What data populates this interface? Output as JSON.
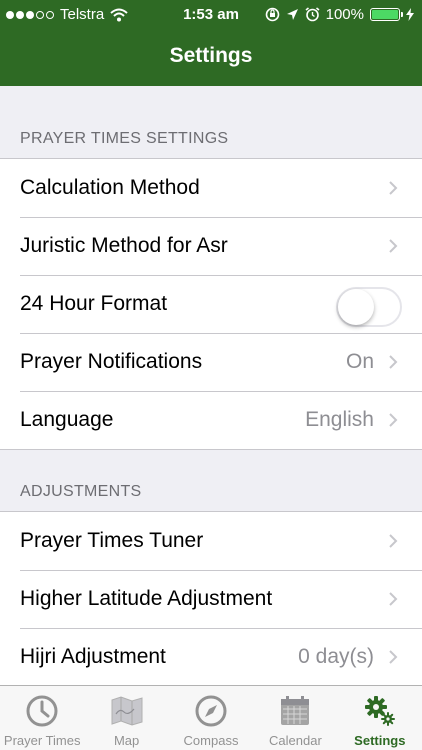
{
  "statusbar": {
    "carrier": "Telstra",
    "time": "1:53 am",
    "battery": "100%",
    "battery_level": 1.0
  },
  "nav": {
    "title": "Settings"
  },
  "colors": {
    "brand": "#2e6a24",
    "battery": "#4cd964",
    "tab_inactive": "#929292"
  },
  "sections": [
    {
      "header": "PRAYER TIMES SETTINGS",
      "rows": [
        {
          "label": "Calculation Method",
          "value": ""
        },
        {
          "label": "Juristic Method for Asr",
          "value": ""
        },
        {
          "label": "24 Hour Format",
          "toggle": false
        },
        {
          "label": "Prayer Notifications",
          "value": "On"
        },
        {
          "label": "Language",
          "value": "English"
        }
      ]
    },
    {
      "header": "ADJUSTMENTS",
      "rows": [
        {
          "label": "Prayer Times Tuner",
          "value": ""
        },
        {
          "label": "Higher Latitude Adjustment",
          "value": ""
        },
        {
          "label": "Hijri Adjustment",
          "value": "0 day(s)"
        }
      ]
    }
  ],
  "tabs": [
    {
      "label": "Prayer Times",
      "icon": "clock-icon",
      "active": false
    },
    {
      "label": "Map",
      "icon": "map-icon",
      "active": false
    },
    {
      "label": "Compass",
      "icon": "compass-icon",
      "active": false
    },
    {
      "label": "Calendar",
      "icon": "calendar-icon",
      "active": false
    },
    {
      "label": "Settings",
      "icon": "gears-icon",
      "active": true
    }
  ]
}
